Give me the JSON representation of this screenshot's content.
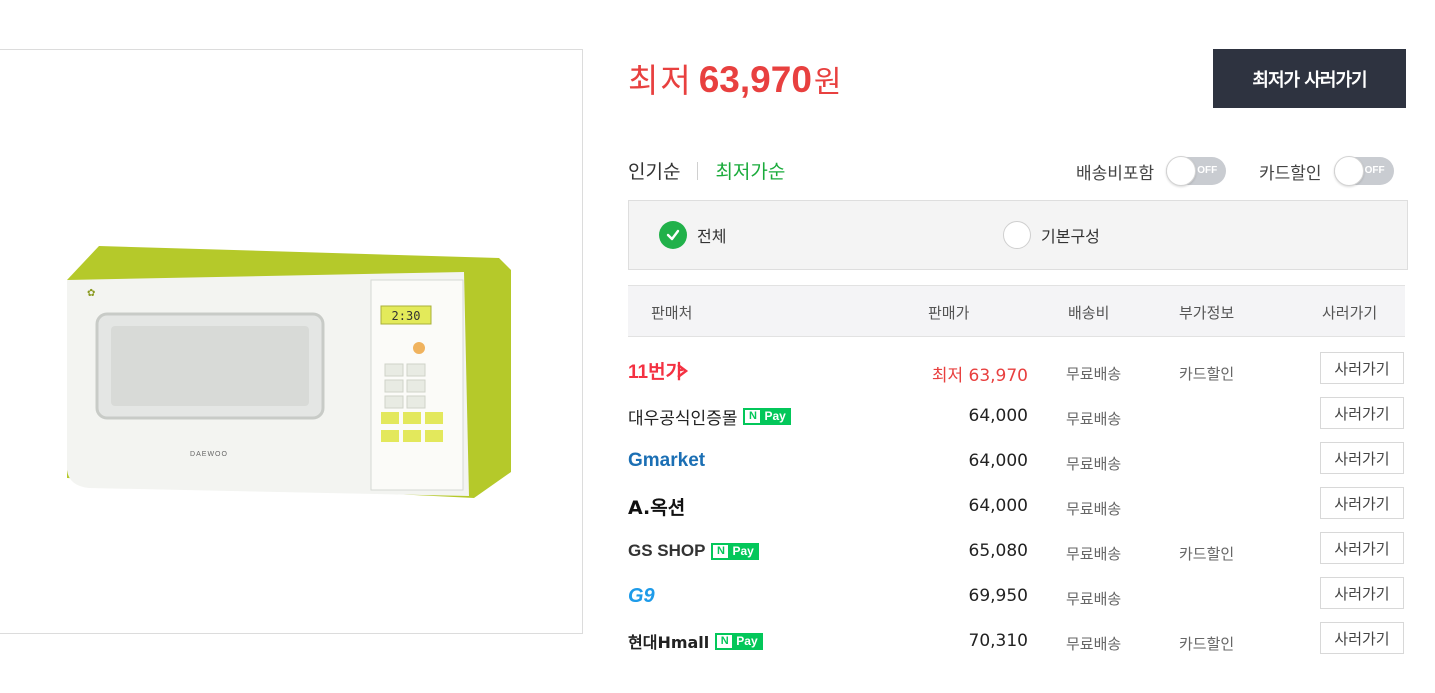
{
  "header": {
    "price_label": "최저",
    "price_value": "63,970",
    "price_unit": "원",
    "buy_lowest_label": "최저가 사러가기"
  },
  "sort": {
    "popular_label": "인기순",
    "lowest_label": "최저가순"
  },
  "toggles": {
    "shipping_label": "배송비포함",
    "shipping_state": "OFF",
    "card_label": "카드할인",
    "card_state": "OFF"
  },
  "filters": {
    "all_label": "전체",
    "basic_label": "기본구성"
  },
  "table": {
    "headers": [
      "판매처",
      "판매가",
      "배송비",
      "부가정보",
      "사러가기"
    ],
    "rows": [
      {
        "seller": "11번가",
        "price": "최저 63,970",
        "shipping": "무료배송",
        "info": "카드할인",
        "buy": "사러가기"
      },
      {
        "seller": "대우공식인증몰",
        "npay": "Pay",
        "price": "64,000",
        "shipping": "무료배송",
        "info": "",
        "buy": "사러가기"
      },
      {
        "seller": "Gmarket",
        "price": "64,000",
        "shipping": "무료배송",
        "info": "",
        "buy": "사러가기"
      },
      {
        "seller": "A.옥션",
        "price": "64,000",
        "shipping": "무료배송",
        "info": "",
        "buy": "사러가기"
      },
      {
        "seller": "GS SHOP",
        "npay": "Pay",
        "price": "65,080",
        "shipping": "무료배송",
        "info": "카드할인",
        "buy": "사러가기"
      },
      {
        "seller": "G9",
        "price": "69,950",
        "shipping": "무료배송",
        "info": "",
        "buy": "사러가기"
      },
      {
        "seller": "현대Hmall",
        "npay": "Pay",
        "price": "70,310",
        "shipping": "무료배송",
        "info": "카드할인",
        "buy": "사러가기"
      }
    ]
  },
  "product": {
    "brand_text": "DAEWOO",
    "display_text": "2:30"
  },
  "colors": {
    "accent_red": "#e8403f",
    "accent_green": "#1aab3b",
    "npay_green": "#03c75a",
    "dark_button": "#2e3340",
    "microwave_body": "#b8cc2a"
  }
}
